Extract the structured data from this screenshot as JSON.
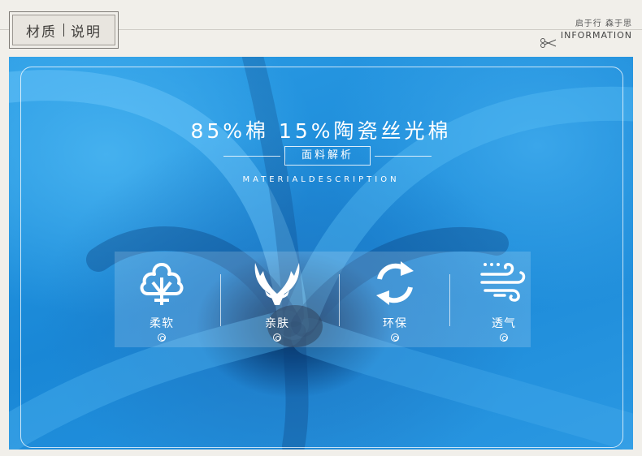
{
  "header": {
    "tag_left": "材质",
    "tag_right": "说明",
    "slogan": "启于行 森于思",
    "info": "INFORMATION"
  },
  "panel": {
    "title": "85%棉 15%陶瓷丝光棉",
    "subtitle": "面料解析",
    "subtitle_en": "MATERIALDESCRIPTION"
  },
  "features": [
    {
      "label": "柔软",
      "icon": "cotton-icon"
    },
    {
      "label": "亲肤",
      "icon": "hands-icon"
    },
    {
      "label": "环保",
      "icon": "recycle-icon"
    },
    {
      "label": "透气",
      "icon": "wind-icon"
    }
  ],
  "colors": {
    "background": "#f1efea",
    "fabric": "#1f8ad8",
    "text_on_fabric": "#ffffff"
  }
}
